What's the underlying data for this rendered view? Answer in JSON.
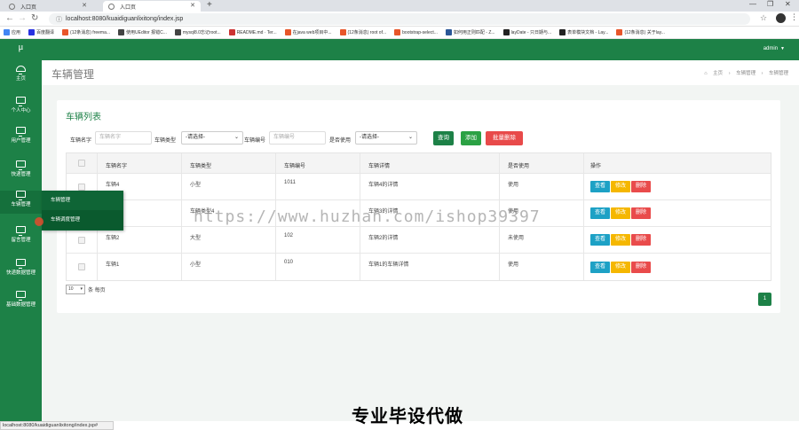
{
  "browser": {
    "tabs": [
      {
        "label": "入口页",
        "active": false
      },
      {
        "label": "入口页",
        "active": true
      }
    ],
    "url": "localhost:8080/kuaidiguanlixitong/index.jsp",
    "bookmarks": [
      {
        "label": "应用",
        "color": "#4285f4"
      },
      {
        "label": "百度翻译",
        "color": "#2932e1"
      },
      {
        "label": "(12条消息) freema...",
        "color": "#e8562a"
      },
      {
        "label": "使用UEditor 报错C...",
        "color": "#444444"
      },
      {
        "label": "mysql8.0忘记root...",
        "color": "#444444"
      },
      {
        "label": "README.md · Ter...",
        "color": "#cc3333"
      },
      {
        "label": "在java web项目中...",
        "color": "#e8562a"
      },
      {
        "label": "(12条消息) root of...",
        "color": "#e8562a"
      },
      {
        "label": "bootstrap-select...",
        "color": "#e8562a"
      },
      {
        "label": "如何用正则匹配 - Z...",
        "color": "#2b5797"
      },
      {
        "label": "layDate - 只日期与...",
        "color": "#222222"
      },
      {
        "label": "表单模块文档 - Lay...",
        "color": "#222222"
      },
      {
        "label": "(12条消息) 关于lay...",
        "color": "#e8562a"
      }
    ],
    "status_url": "localhost:8080/kuaidiguanlixitong/index.jsp#"
  },
  "sidebar": {
    "logo": "μ",
    "items": [
      {
        "label": "主页",
        "icon": "dashboard-icon"
      },
      {
        "label": "个人中心",
        "icon": "monitor-icon"
      },
      {
        "label": "用户管理",
        "icon": "monitor-icon"
      },
      {
        "label": "快递管理",
        "icon": "monitor-icon"
      },
      {
        "label": "车辆管理",
        "icon": "monitor-icon"
      },
      {
        "label": "留言管理",
        "icon": "monitor-icon"
      },
      {
        "label": "快递数据管理",
        "icon": "monitor-icon"
      },
      {
        "label": "基础数据管理",
        "icon": "monitor-icon"
      }
    ],
    "submenu": [
      "车辆管理",
      "车辆调度管理"
    ]
  },
  "topbar": {
    "user": "admin"
  },
  "page": {
    "title": "车辆管理",
    "breadcrumb": [
      "主页",
      "车辆管理",
      "车辆管理"
    ]
  },
  "panel": {
    "title": "车辆列表",
    "filters": {
      "name_label": "车辆名字",
      "name_placeholder": "车辆名字",
      "type_label": "车辆类型",
      "type_value": "-请选择-",
      "number_label": "车辆编号",
      "number_placeholder": "车辆编号",
      "used_label": "是否使用",
      "used_value": "-请选择-"
    },
    "buttons": {
      "query": "查询",
      "add": "添加",
      "batch_delete": "批量删除"
    },
    "columns": [
      "车辆名字",
      "车辆类型",
      "车辆编号",
      "车辆详情",
      "是否使用",
      "操作"
    ],
    "rows": [
      {
        "name": "车辆4",
        "type": "小型",
        "number": "1011",
        "detail": "车辆4的详情",
        "used": "使用"
      },
      {
        "name": "",
        "type": "车辆类型4",
        "number": "",
        "detail": "车辆3的详情",
        "used": "使用"
      },
      {
        "name": "车辆2",
        "type": "大型",
        "number": "102",
        "detail": "车辆2的详情",
        "used": "未使用"
      },
      {
        "name": "车辆1",
        "type": "小型",
        "number": "010",
        "detail": "车辆1的车辆详情",
        "used": "使用"
      }
    ],
    "actions": {
      "view": "查看",
      "edit": "修改",
      "delete": "删除"
    },
    "pagesize": "10",
    "pagesize_suffix": "条 每页",
    "page": "1"
  },
  "overlay": {
    "watermark": "https://www.huzhan.com/ishop39397",
    "banner": "专业毕设代做"
  },
  "colors": {
    "brand": "#1d8147",
    "danger": "#e84a4a",
    "info": "#1da1c5",
    "warn": "#f5b700"
  }
}
